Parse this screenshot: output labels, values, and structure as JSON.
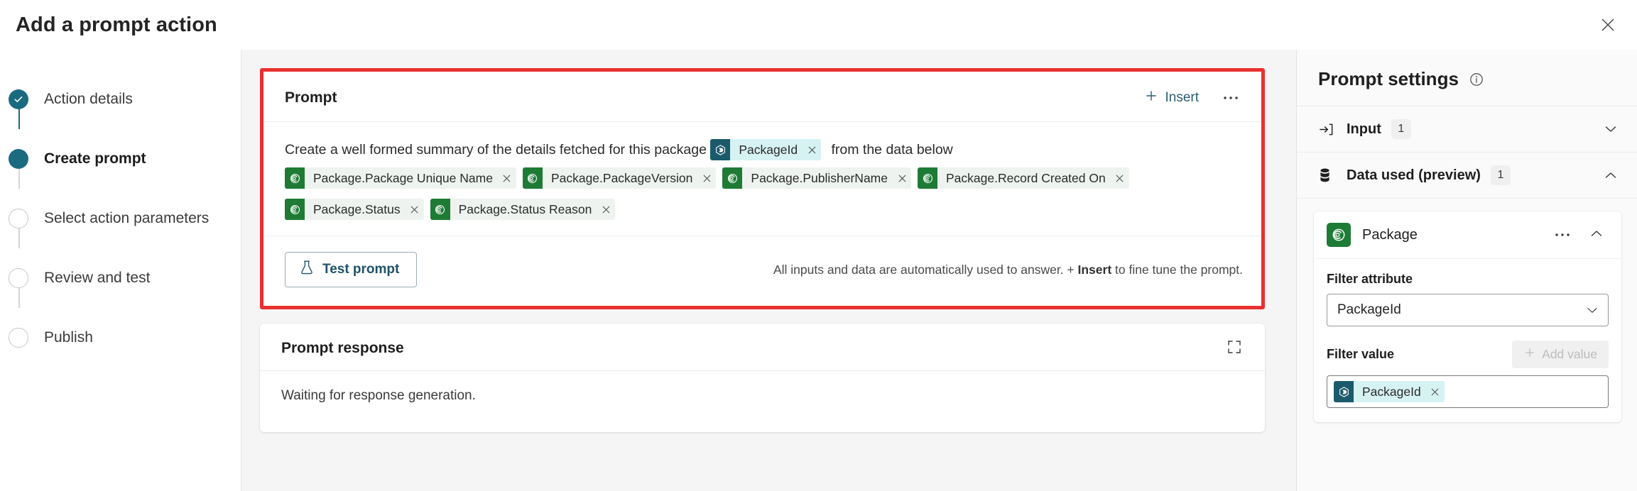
{
  "window": {
    "title": "Add a prompt action",
    "close_icon": "close-icon"
  },
  "stepper": {
    "steps": [
      {
        "label": "Action details",
        "state": "done"
      },
      {
        "label": "Create prompt",
        "state": "current"
      },
      {
        "label": "Select action parameters",
        "state": "todo"
      },
      {
        "label": "Review and test",
        "state": "todo"
      },
      {
        "label": "Publish",
        "state": "todo"
      }
    ]
  },
  "prompt_card": {
    "title": "Prompt",
    "insert_label": "Insert",
    "more_label": "···",
    "text_before": "Create a well formed summary of the details fetched for this package",
    "inline_token": {
      "label": "PackageId",
      "type": "teal",
      "icon": "dataverse-token-icon",
      "remove_icon": "close-icon"
    },
    "text_after": "from the data below",
    "tokens": [
      {
        "label": "Package.Package Unique Name",
        "type": "green",
        "icon": "table-token-icon",
        "remove_icon": "close-icon"
      },
      {
        "label": "Package.PackageVersion",
        "type": "green",
        "icon": "table-token-icon",
        "remove_icon": "close-icon"
      },
      {
        "label": "Package.PublisherName",
        "type": "green",
        "icon": "table-token-icon",
        "remove_icon": "close-icon"
      },
      {
        "label": "Package.Record Created On",
        "type": "green",
        "icon": "table-token-icon",
        "remove_icon": "close-icon"
      },
      {
        "label": "Package.Status",
        "type": "green",
        "icon": "table-token-icon",
        "remove_icon": "close-icon"
      },
      {
        "label": "Package.Status Reason",
        "type": "green",
        "icon": "table-token-icon",
        "remove_icon": "close-icon"
      }
    ],
    "test_button": {
      "label": "Test prompt",
      "icon": "flask-icon"
    },
    "hint_prefix": "All inputs and data are automatically used to answer. + ",
    "hint_bold": "Insert",
    "hint_suffix": " to fine tune the prompt."
  },
  "response_card": {
    "title": "Prompt response",
    "expand_icon": "expand-icon",
    "body_text": "Waiting for response generation."
  },
  "settings": {
    "title": "Prompt settings",
    "info_icon": "info-icon",
    "input_section": {
      "label": "Input",
      "count": "1",
      "icon": "input-arrow-icon",
      "chevron": "chevron-down-icon"
    },
    "data_section": {
      "label": "Data used (preview)",
      "count": "1",
      "icon": "database-icon",
      "chevron": "chevron-up-icon"
    },
    "entity_card": {
      "name": "Package",
      "icon": "table-token-icon",
      "more_label": "···",
      "chevron": "chevron-up-icon",
      "filter_attribute_label": "Filter attribute",
      "filter_attribute_value": "PackageId",
      "filter_value_label": "Filter value",
      "add_value_label": "Add value",
      "filter_value_token": {
        "label": "PackageId",
        "type": "teal",
        "icon": "dataverse-token-icon",
        "remove_icon": "close-icon"
      }
    }
  },
  "colors": {
    "accent_teal": "#1b6b80",
    "token_teal_bg": "#d7f2f3",
    "token_teal_icon": "#1b5a6b",
    "token_green_bg": "#eef3ef",
    "token_green_icon": "#1e7b35",
    "highlight_red": "#e8312f",
    "canvas_gray": "#f5f5f5",
    "panel_gray": "#fafafa"
  }
}
